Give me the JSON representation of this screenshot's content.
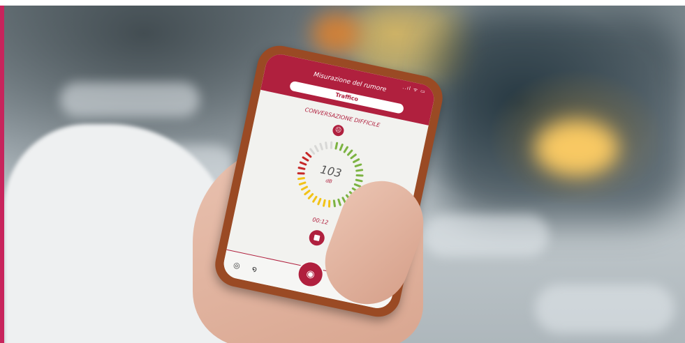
{
  "app": {
    "title": "Misurazione del rumore",
    "status_icons": "..ıl ᯤ ▭",
    "mode_pill": "Traffico"
  },
  "measurement": {
    "status_text": "CONVERSAZIONE DIFFICILE",
    "status_icon": "sad-face-icon",
    "value": "103",
    "unit": "dB",
    "timer": "00:12",
    "gauge_level": 0.85
  },
  "gauge_colors": {
    "low": "#7cb342",
    "mid": "#f2c318",
    "high": "#c62828",
    "inactive": "#d8d8d6"
  },
  "nav": {
    "items": [
      "headset-icon",
      "ear-icon",
      "record-icon",
      "document-icon",
      "brand-icon"
    ],
    "accent": "#b0203e"
  },
  "colors": {
    "brand": "#b0203e",
    "page_accent": "#c8245c"
  }
}
